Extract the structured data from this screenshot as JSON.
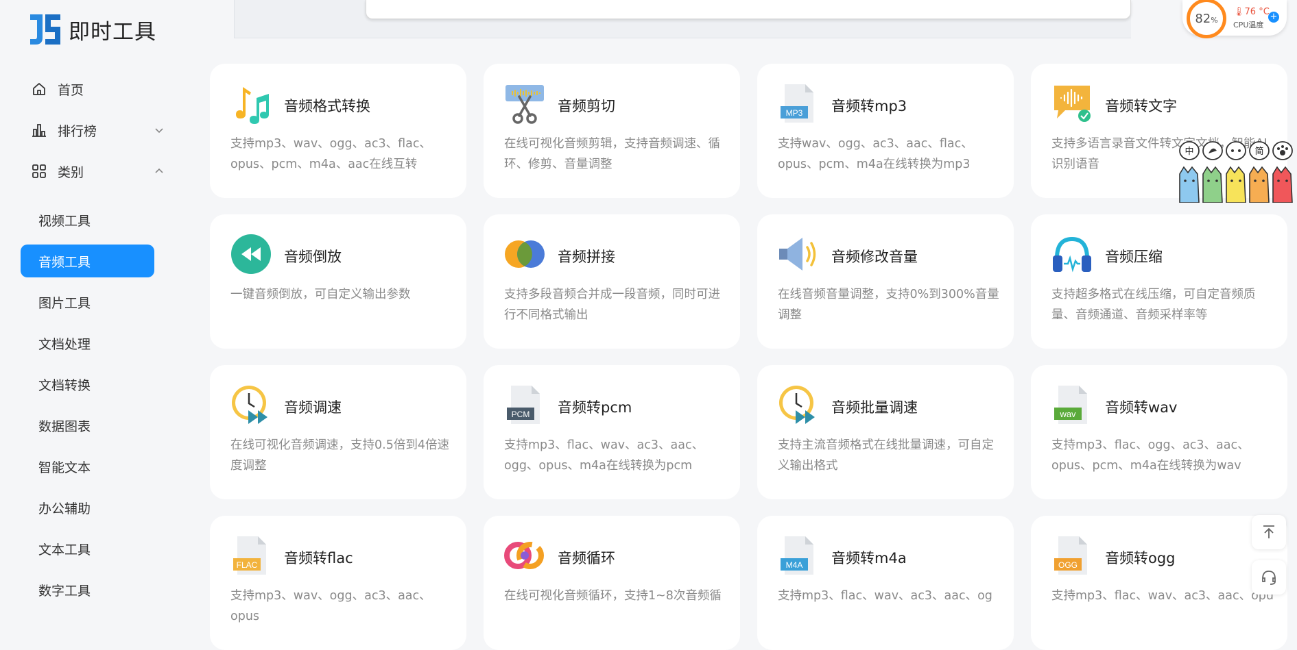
{
  "app": {
    "title": "即时工具"
  },
  "sidebar": {
    "nav": [
      {
        "label": "首页",
        "icon": "home-icon"
      },
      {
        "label": "排行榜",
        "icon": "bar-chart-icon",
        "expanded": false
      },
      {
        "label": "类别",
        "icon": "grid-icon",
        "expanded": true
      }
    ],
    "categories": [
      {
        "label": "视频工具"
      },
      {
        "label": "音频工具",
        "active": true
      },
      {
        "label": "图片工具"
      },
      {
        "label": "文档处理"
      },
      {
        "label": "文档转换"
      },
      {
        "label": "数据图表"
      },
      {
        "label": "智能文本"
      },
      {
        "label": "办公辅助"
      },
      {
        "label": "文本工具"
      },
      {
        "label": "数字工具"
      }
    ]
  },
  "widget": {
    "cpu_usage": "82",
    "cpu_unit": "%",
    "temperature": "76 °C",
    "temperature_label": "CPU温度",
    "add_label": "+"
  },
  "mascot": {
    "chars": [
      "中",
      "",
      "",
      "简",
      ""
    ]
  },
  "tools": [
    {
      "title": "音频格式转换",
      "desc": "支持mp3、wav、ogg、ac3、flac、opus、pcm、m4a、aac在线互转",
      "icon": "music-notes-icon"
    },
    {
      "title": "音频剪切",
      "desc": "在线可视化音频剪辑，支持音频调速、循环、修剪、音量调整",
      "icon": "scissors-icon"
    },
    {
      "title": "音频转mp3",
      "desc": "支持wav、ogg、ac3、aac、flac、opus、pcm、m4a在线转换为mp3",
      "icon": "mp3-file-icon",
      "badge": "MP3"
    },
    {
      "title": "音频转文字",
      "desc": "支持多语言录音文件转文字文档，智能AI识别语音",
      "icon": "speech-to-text-icon"
    },
    {
      "title": "音频倒放",
      "desc": "一键音频倒放，可自定义输出参数",
      "icon": "rewind-icon"
    },
    {
      "title": "音频拼接",
      "desc": "支持多段音频合并成一段音频，同时可进行不同格式输出",
      "icon": "merge-circles-icon"
    },
    {
      "title": "音频修改音量",
      "desc": "在线音频音量调整，支持0%到300%音量调整",
      "icon": "speaker-icon"
    },
    {
      "title": "音频压缩",
      "desc": "支持超多格式在线压缩，可自定音频质量、音频通道、音频采样率等",
      "icon": "headphones-icon"
    },
    {
      "title": "音频调速",
      "desc": "在线可视化音频调速，支持0.5倍到4倍速度调整",
      "icon": "speed-clock-icon"
    },
    {
      "title": "音频转pcm",
      "desc": "支持mp3、flac、wav、ac3、aac、ogg、opus、m4a在线转换为pcm",
      "icon": "pcm-file-icon",
      "badge": "PCM"
    },
    {
      "title": "音频批量调速",
      "desc": "支持主流音频格式在线批量调速，可自定义输出格式",
      "icon": "batch-speed-clock-icon"
    },
    {
      "title": "音频转wav",
      "desc": "支持mp3、flac、ogg、ac3、aac、opus、pcm、m4a在线转换为wav",
      "icon": "wav-file-icon",
      "badge": "wav"
    },
    {
      "title": "音频转flac",
      "desc": "支持mp3、wav、ogg、ac3、aac、opus",
      "icon": "flac-file-icon",
      "badge": "FLAC"
    },
    {
      "title": "音频循环",
      "desc": "在线可视化音频循环，支持1~8次音频循",
      "icon": "loop-rings-icon"
    },
    {
      "title": "音频转m4a",
      "desc": "支持mp3、flac、wav、ac3、aac、og",
      "icon": "m4a-file-icon",
      "badge": "M4A"
    },
    {
      "title": "音频转ogg",
      "desc": "支持mp3、flac、wav、ac3、aac、opu",
      "icon": "ogg-file-icon",
      "badge": "OGG"
    }
  ],
  "colors": {
    "accent": "#1890ff",
    "mp3": "#4a9fd8",
    "pcm": "#4a5b6b",
    "wav": "#5aaa3a",
    "flac": "#f2b33d",
    "m4a": "#3aa0d8",
    "ogg": "#f0a030"
  }
}
